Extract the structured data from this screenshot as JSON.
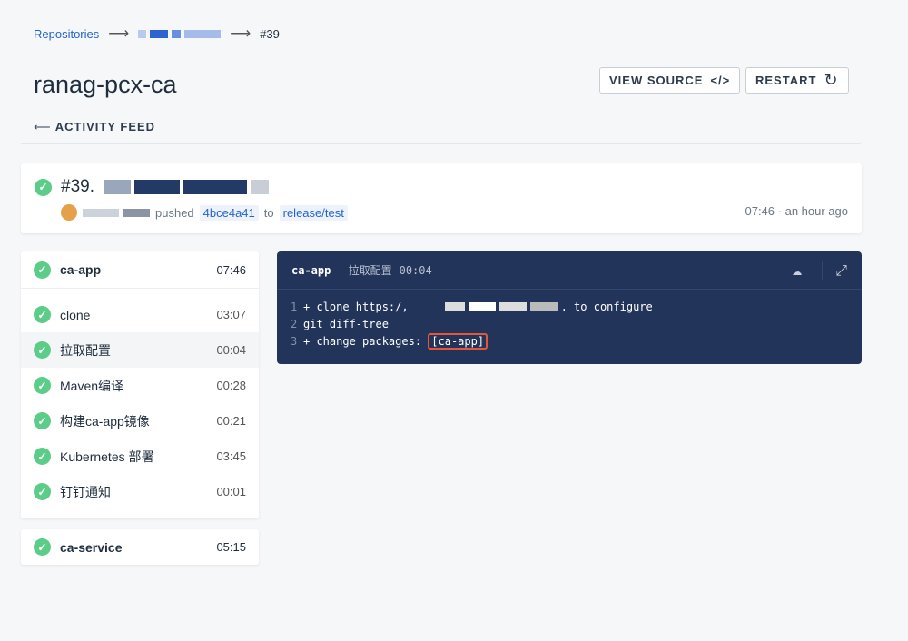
{
  "breadcrumb": {
    "root": "Repositories",
    "build": "#39"
  },
  "header": {
    "title": "ranag-pcx-ca",
    "view_source": "VIEW SOURCE",
    "restart": "RESTART",
    "back": "ACTIVITY FEED"
  },
  "build": {
    "number": "#39.",
    "pushed": "pushed",
    "commit": "4bce4a41",
    "to": "to",
    "branch": "release/test",
    "time": "07:46",
    "ago": "an hour ago"
  },
  "stages": [
    {
      "name": "ca-app",
      "time": "07:46",
      "steps": [
        {
          "name": "clone",
          "time": "03:07"
        },
        {
          "name": "拉取配置",
          "time": "00:04"
        },
        {
          "name": "Maven编译",
          "time": "00:28"
        },
        {
          "name": "构建ca-app镜像",
          "time": "00:21"
        },
        {
          "name": "Kubernetes 部署",
          "time": "03:45"
        },
        {
          "name": "钉钉通知",
          "time": "00:01"
        }
      ]
    },
    {
      "name": "ca-service",
      "time": "05:15"
    }
  ],
  "log": {
    "stage": "ca-app",
    "sep": "—",
    "step": "拉取配置",
    "time": "00:04",
    "lines": [
      {
        "n": "1",
        "pre": "+ clone https:/,",
        "post": ". to configure"
      },
      {
        "n": "2",
        "text": "git diff-tree"
      },
      {
        "n": "3",
        "text": "+ change packages: ",
        "hl": "[ca-app]"
      }
    ]
  }
}
